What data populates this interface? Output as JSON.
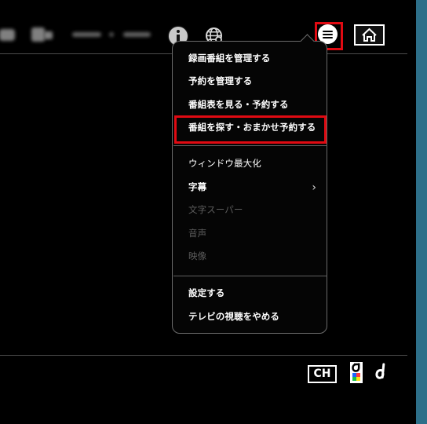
{
  "menu": {
    "items": [
      {
        "label": "録画番組を管理する"
      },
      {
        "label": "予約を管理する"
      },
      {
        "label": "番組表を見る・予約する"
      },
      {
        "label": "番組を探す・おまかせ予約する"
      },
      {
        "label": "ウィンドウ最大化"
      },
      {
        "label": "字幕"
      },
      {
        "label": "文字スーパー"
      },
      {
        "label": "音声"
      },
      {
        "label": "映像"
      },
      {
        "label": "設定する"
      },
      {
        "label": "テレビの視聴をやめる"
      }
    ]
  },
  "bottom_controls": {
    "ch_label": "CH"
  }
}
